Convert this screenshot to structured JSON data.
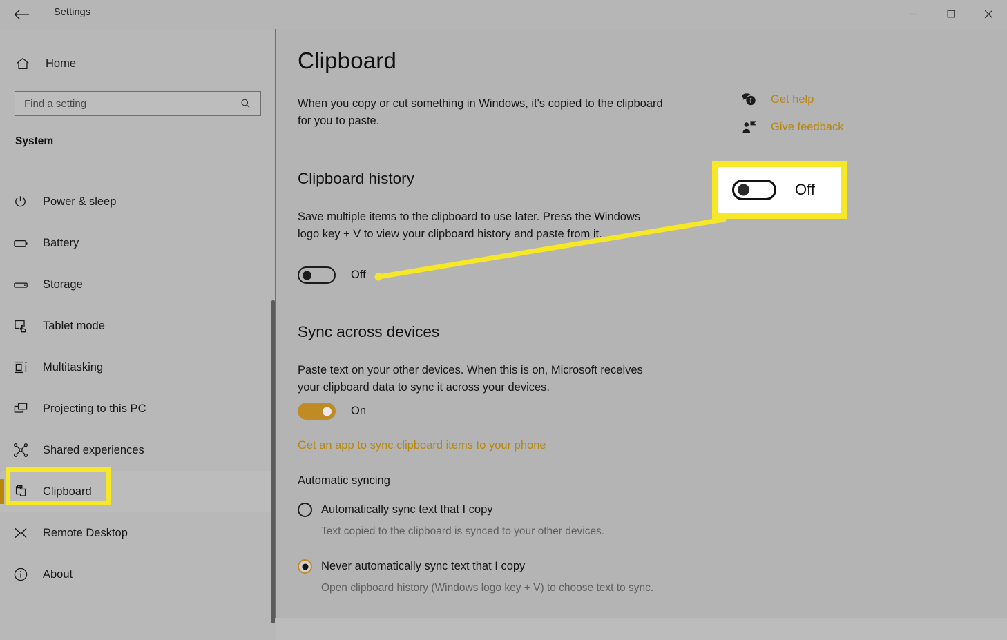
{
  "window": {
    "title": "Settings",
    "back_icon": "back-arrow-icon",
    "minimize_label": "Minimize",
    "maximize_label": "Maximize",
    "close_label": "Close"
  },
  "sidebar": {
    "home_label": "Home",
    "home_icon": "home-icon",
    "search": {
      "placeholder": "Find a setting",
      "value": "",
      "icon": "search-icon"
    },
    "group_title": "System",
    "items": [
      {
        "label": "Power & sleep",
        "icon": "power-icon",
        "selected": false
      },
      {
        "label": "Battery",
        "icon": "battery-icon",
        "selected": false
      },
      {
        "label": "Storage",
        "icon": "storage-icon",
        "selected": false
      },
      {
        "label": "Tablet mode",
        "icon": "tablet-mode-icon",
        "selected": false
      },
      {
        "label": "Multitasking",
        "icon": "multitasking-icon",
        "selected": false
      },
      {
        "label": "Projecting to this PC",
        "icon": "projecting-icon",
        "selected": false
      },
      {
        "label": "Shared experiences",
        "icon": "shared-experiences-icon",
        "selected": false
      },
      {
        "label": "Clipboard",
        "icon": "clipboard-icon",
        "selected": true
      },
      {
        "label": "Remote Desktop",
        "icon": "remote-desktop-icon",
        "selected": false
      },
      {
        "label": "About",
        "icon": "about-info-icon",
        "selected": false
      }
    ]
  },
  "main": {
    "page_title": "Clipboard",
    "intro": "When you copy or cut something in Windows, it's copied to the clipboard for you to paste.",
    "help_links": [
      {
        "label": "Get help",
        "icon": "get-help-icon"
      },
      {
        "label": "Give feedback",
        "icon": "give-feedback-icon"
      }
    ],
    "clipboard_history": {
      "heading": "Clipboard history",
      "description": "Save multiple items to the clipboard to use later. Press the Windows logo key + V to view your clipboard history and paste from it.",
      "toggle_state": "Off"
    },
    "sync_across_devices": {
      "heading": "Sync across devices",
      "description": "Paste text on your other devices. When this is on, Microsoft receives your clipboard data to sync it across your devices.",
      "toggle_state": "On",
      "link": "Get an app to sync clipboard items to your phone"
    },
    "automatic_syncing": {
      "heading": "Automatic syncing",
      "options": [
        {
          "label": "Automatically sync text that I copy",
          "description": "Text copied to the clipboard is synced to your other devices.",
          "checked": false
        },
        {
          "label": "Never automatically sync text that I copy",
          "description": "Open clipboard history (Windows logo key + V) to choose text to sync.",
          "checked": true
        }
      ]
    }
  },
  "annotation": {
    "callout_state": "Off",
    "highlight_color": "#f7e827",
    "accent_color": "#b8860b"
  }
}
